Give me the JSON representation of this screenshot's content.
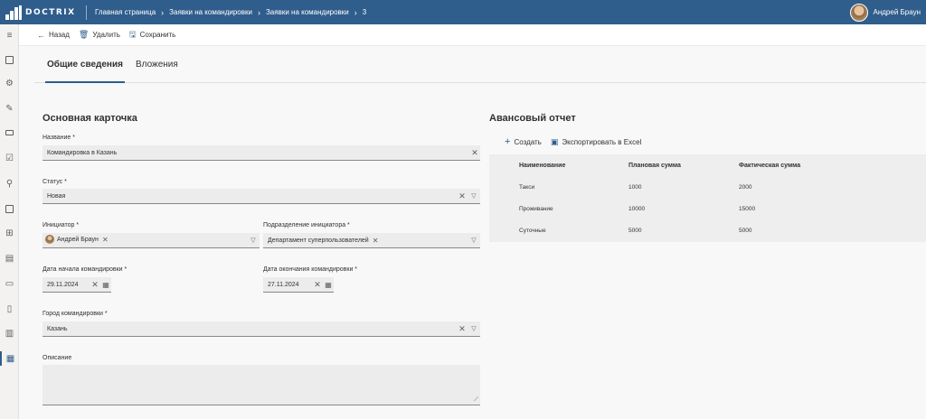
{
  "topbar": {
    "logo_text": "DOCTRIX",
    "breadcrumb": [
      "Главная страница",
      "Заявки на командировки",
      "Заявки на командировки",
      "3"
    ],
    "user_name": "Андрей Браун"
  },
  "toolbar": {
    "back_label": "Назад",
    "delete_label": "Удалить",
    "save_label": "Сохранить"
  },
  "tabs": [
    {
      "label": "Общие сведения",
      "active": true
    },
    {
      "label": "Вложения",
      "active": false
    }
  ],
  "form": {
    "title": "Основная карточка",
    "name_label": "Название *",
    "name_value": "Командировка в Казань",
    "status_label": "Статус *",
    "status_value": "Новая",
    "initiator_label": "Инициатор *",
    "initiator_value": "Андрей Браун",
    "department_label": "Подразделение инициатора *",
    "department_value": "Департамент суперпользователей",
    "start_date_label": "Дата начала командировки *",
    "start_date_value": "29.11.2024",
    "end_date_label": "Дата окончания командировки *",
    "end_date_value": "27.11.2024",
    "city_label": "Город командировки *",
    "city_value": "Казань",
    "description_label": "Описание"
  },
  "report": {
    "title": "Авансовый отчет",
    "create_label": "Создать",
    "export_label": "Экспортировать в Excel",
    "columns": [
      "Наименование",
      "Плановая сумма",
      "Фактическая сумма"
    ],
    "rows": [
      [
        "Такси",
        "1000",
        "2000"
      ],
      [
        "Проживание",
        "10000",
        "15000"
      ],
      [
        "Суточные",
        "5000",
        "5000"
      ]
    ]
  },
  "icons": {
    "rail": [
      "menu-icon",
      "dashboard-icon",
      "settings-icon",
      "edit-icon",
      "card-icon",
      "checkbox-icon",
      "org-icon",
      "layout-icon",
      "apps-icon",
      "document-icon",
      "chat-icon",
      "file-icon",
      "list-icon",
      "report-icon"
    ]
  },
  "colors": {
    "brand": "#2f5d8c",
    "field_bg": "#ececec"
  }
}
